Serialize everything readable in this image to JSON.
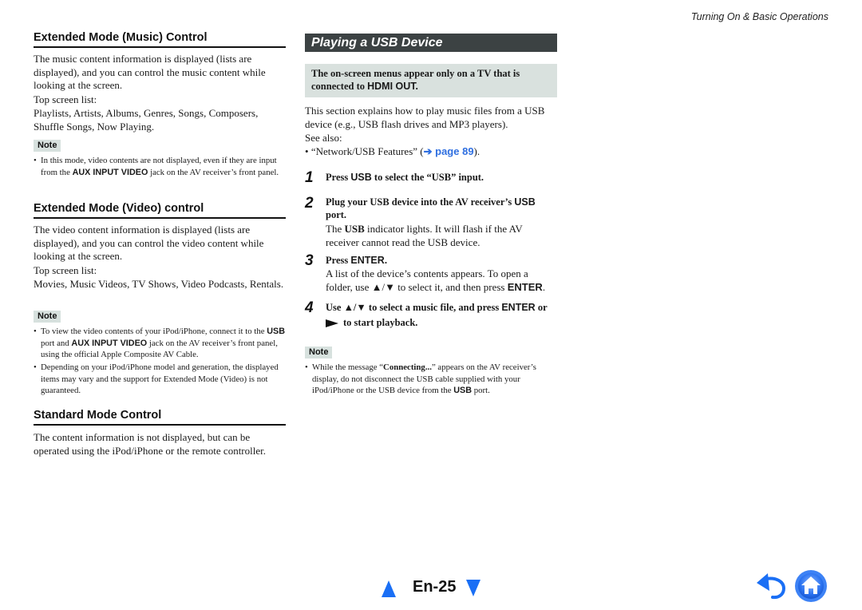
{
  "header": {
    "section_title": "Turning On & Basic Operations"
  },
  "left": {
    "music": {
      "heading": "Extended Mode (Music) Control",
      "para1": "The music content information is displayed (lists are displayed), and you can control the music content while looking at the screen.",
      "list_label": "Top screen list:",
      "list": "Playlists, Artists, Albums, Genres, Songs, Composers, Shuffle Songs, Now Playing.",
      "note_label": "Note",
      "note": {
        "pre": "In this mode, video contents are not displayed, even if they are input from the ",
        "bold": "AUX INPUT VIDEO",
        "post": " jack on the AV receiver’s front panel."
      }
    },
    "video": {
      "heading": "Extended Mode (Video) control",
      "para1": "The video content information is displayed (lists are displayed), and you can control the video content while looking at the screen.",
      "list_label": "Top screen list:",
      "list": "Movies, Music Videos, TV Shows, Video Podcasts, Rentals.",
      "note_label": "Note",
      "notes": [
        {
          "pre": "To view the video contents of your iPod/iPhone, connect it to the ",
          "bold1": "USB",
          "mid": " port and ",
          "bold2": "AUX INPUT VIDEO",
          "post": " jack on the AV receiver’s front panel, using the official Apple Composite AV Cable."
        },
        {
          "text": "Depending on your iPod/iPhone model and generation, the displayed items may vary and the support for Extended Mode (Video) is not guaranteed."
        }
      ]
    },
    "standard": {
      "heading": "Standard Mode Control",
      "para1": "The content information is not displayed, but can be operated using the iPod/iPhone or the remote controller."
    }
  },
  "mid": {
    "section_title": "Playing a USB Device",
    "callout": {
      "pre": "The on-screen menus appear only on a TV that is connected to ",
      "bold": "HDMI OUT."
    },
    "intro": "This section explains how to play music files from a USB device (e.g., USB flash drives and MP3 players).",
    "see_also": "See also:",
    "see_also_item": {
      "pre": "“Network/USB Features” (",
      "link": "➔ page 89",
      "post": ")."
    },
    "steps": [
      {
        "num": "1",
        "t_pre": "Press ",
        "t_bold": "USB",
        "t_post": " to select the “USB” input."
      },
      {
        "num": "2",
        "t_pre": "Plug your USB device into the AV receiver’s ",
        "t_bold": "USB",
        "t_post": " port.",
        "b_pre": "The ",
        "b_bold": "USB",
        "b_post": " indicator lights. It will flash if the AV receiver cannot read the USB device."
      },
      {
        "num": "3",
        "t_pre": "Press ",
        "t_bold": "ENTER.",
        "t_post": "",
        "b_pre": "A list of the device’s contents appears. To open a folder, use ▲/▼ to select it, and then press ",
        "b_bold": "ENTER",
        "b_post": "."
      },
      {
        "num": "4",
        "t_pre": "Use ▲/▼ to select a music file, and press ",
        "t_bold": "ENTER",
        "t_post": " or",
        "t2": "to start playback."
      }
    ],
    "note_label": "Note",
    "note": {
      "pre": "While the message “",
      "bold1": "Connecting...",
      "mid": "” appears on the AV receiver’s display, do not disconnect the USB cable supplied with your iPod/iPhone or the USB device from the ",
      "bold2": "USB",
      "post": " port."
    }
  },
  "footer": {
    "page_label": "En-25",
    "accent_color": "#1a6ff5"
  }
}
